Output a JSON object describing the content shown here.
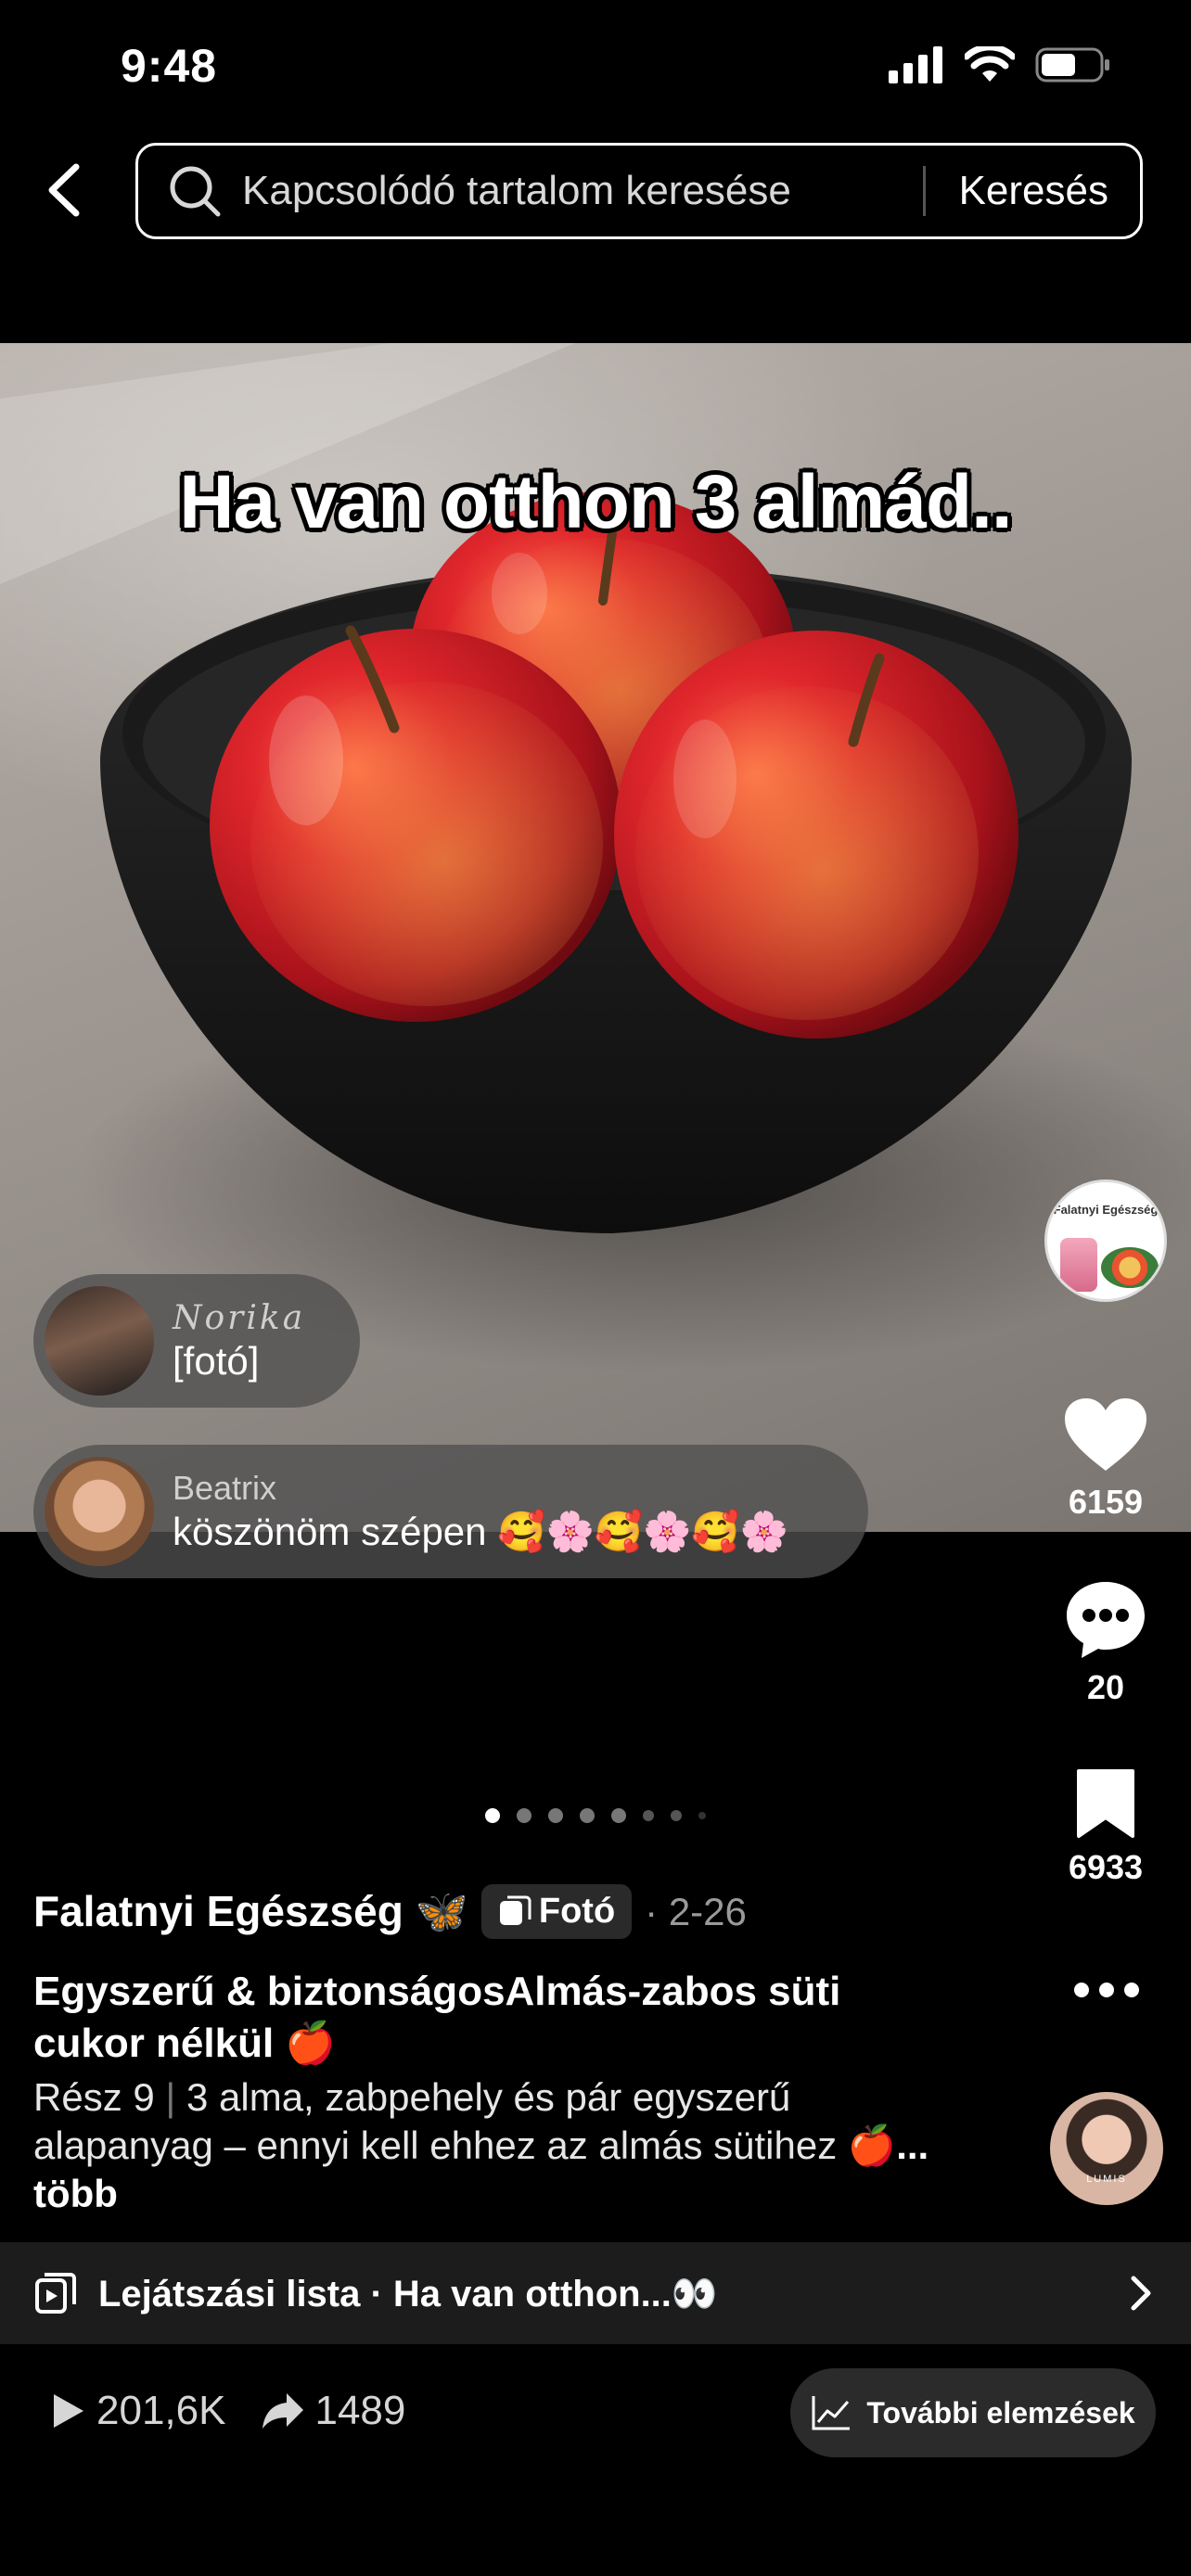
{
  "status_bar": {
    "time": "9:48"
  },
  "search": {
    "placeholder": "Kapcsolódó tartalom keresése",
    "button": "Keresés"
  },
  "post": {
    "overlay_text": "Ha van otthon 3 almád..",
    "slide_count": 8,
    "active_slide": 1
  },
  "comments": [
    {
      "name": "Norika",
      "text": "[fotó]"
    },
    {
      "name": "Beatrix",
      "text": "köszönöm szépen 🥰🌸🥰🌸🥰🌸"
    }
  ],
  "rail": {
    "creator_avatar_text": "Falatnyi Egészség",
    "likes": "6159",
    "comments": "20",
    "saves": "6933"
  },
  "caption": {
    "author": "Falatnyi Egészség 🦋",
    "type_badge": "Fotó",
    "date": "· 2-26",
    "title": "Egyszerű & biztonságosAlmás-zabos süti cukor nélkül 🍎",
    "part": "Rész 9",
    "separator": "|",
    "description": "3 alma, zabpehely és pár egyszerű alapanyag – ennyi kell ehhez az almás sütihez 🍎",
    "more": "... több"
  },
  "playlist": {
    "label": "Lejátszási lista · Ha van otthon...👀"
  },
  "stats": {
    "plays": "201,6K",
    "shares": "1489",
    "analytics_button": "További elemzések"
  },
  "music_avatar_text": "LUMIS",
  "colors": {
    "background": "#000000",
    "apple_red": "#d8262b",
    "bubble": "#505050"
  }
}
